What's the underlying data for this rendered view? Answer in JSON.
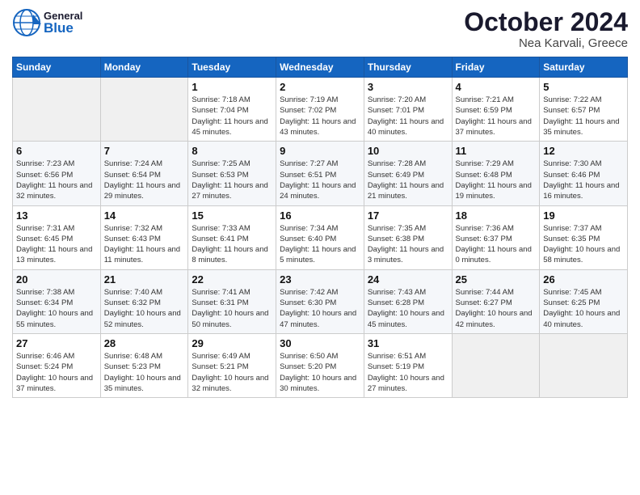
{
  "header": {
    "logo_general": "General",
    "logo_blue": "Blue",
    "title": "October 2024",
    "subtitle": "Nea Karvali, Greece"
  },
  "days_of_week": [
    "Sunday",
    "Monday",
    "Tuesday",
    "Wednesday",
    "Thursday",
    "Friday",
    "Saturday"
  ],
  "weeks": [
    [
      {
        "num": "",
        "info": ""
      },
      {
        "num": "",
        "info": ""
      },
      {
        "num": "1",
        "info": "Sunrise: 7:18 AM\nSunset: 7:04 PM\nDaylight: 11 hours and 45 minutes."
      },
      {
        "num": "2",
        "info": "Sunrise: 7:19 AM\nSunset: 7:02 PM\nDaylight: 11 hours and 43 minutes."
      },
      {
        "num": "3",
        "info": "Sunrise: 7:20 AM\nSunset: 7:01 PM\nDaylight: 11 hours and 40 minutes."
      },
      {
        "num": "4",
        "info": "Sunrise: 7:21 AM\nSunset: 6:59 PM\nDaylight: 11 hours and 37 minutes."
      },
      {
        "num": "5",
        "info": "Sunrise: 7:22 AM\nSunset: 6:57 PM\nDaylight: 11 hours and 35 minutes."
      }
    ],
    [
      {
        "num": "6",
        "info": "Sunrise: 7:23 AM\nSunset: 6:56 PM\nDaylight: 11 hours and 32 minutes."
      },
      {
        "num": "7",
        "info": "Sunrise: 7:24 AM\nSunset: 6:54 PM\nDaylight: 11 hours and 29 minutes."
      },
      {
        "num": "8",
        "info": "Sunrise: 7:25 AM\nSunset: 6:53 PM\nDaylight: 11 hours and 27 minutes."
      },
      {
        "num": "9",
        "info": "Sunrise: 7:27 AM\nSunset: 6:51 PM\nDaylight: 11 hours and 24 minutes."
      },
      {
        "num": "10",
        "info": "Sunrise: 7:28 AM\nSunset: 6:49 PM\nDaylight: 11 hours and 21 minutes."
      },
      {
        "num": "11",
        "info": "Sunrise: 7:29 AM\nSunset: 6:48 PM\nDaylight: 11 hours and 19 minutes."
      },
      {
        "num": "12",
        "info": "Sunrise: 7:30 AM\nSunset: 6:46 PM\nDaylight: 11 hours and 16 minutes."
      }
    ],
    [
      {
        "num": "13",
        "info": "Sunrise: 7:31 AM\nSunset: 6:45 PM\nDaylight: 11 hours and 13 minutes."
      },
      {
        "num": "14",
        "info": "Sunrise: 7:32 AM\nSunset: 6:43 PM\nDaylight: 11 hours and 11 minutes."
      },
      {
        "num": "15",
        "info": "Sunrise: 7:33 AM\nSunset: 6:41 PM\nDaylight: 11 hours and 8 minutes."
      },
      {
        "num": "16",
        "info": "Sunrise: 7:34 AM\nSunset: 6:40 PM\nDaylight: 11 hours and 5 minutes."
      },
      {
        "num": "17",
        "info": "Sunrise: 7:35 AM\nSunset: 6:38 PM\nDaylight: 11 hours and 3 minutes."
      },
      {
        "num": "18",
        "info": "Sunrise: 7:36 AM\nSunset: 6:37 PM\nDaylight: 11 hours and 0 minutes."
      },
      {
        "num": "19",
        "info": "Sunrise: 7:37 AM\nSunset: 6:35 PM\nDaylight: 10 hours and 58 minutes."
      }
    ],
    [
      {
        "num": "20",
        "info": "Sunrise: 7:38 AM\nSunset: 6:34 PM\nDaylight: 10 hours and 55 minutes."
      },
      {
        "num": "21",
        "info": "Sunrise: 7:40 AM\nSunset: 6:32 PM\nDaylight: 10 hours and 52 minutes."
      },
      {
        "num": "22",
        "info": "Sunrise: 7:41 AM\nSunset: 6:31 PM\nDaylight: 10 hours and 50 minutes."
      },
      {
        "num": "23",
        "info": "Sunrise: 7:42 AM\nSunset: 6:30 PM\nDaylight: 10 hours and 47 minutes."
      },
      {
        "num": "24",
        "info": "Sunrise: 7:43 AM\nSunset: 6:28 PM\nDaylight: 10 hours and 45 minutes."
      },
      {
        "num": "25",
        "info": "Sunrise: 7:44 AM\nSunset: 6:27 PM\nDaylight: 10 hours and 42 minutes."
      },
      {
        "num": "26",
        "info": "Sunrise: 7:45 AM\nSunset: 6:25 PM\nDaylight: 10 hours and 40 minutes."
      }
    ],
    [
      {
        "num": "27",
        "info": "Sunrise: 6:46 AM\nSunset: 5:24 PM\nDaylight: 10 hours and 37 minutes."
      },
      {
        "num": "28",
        "info": "Sunrise: 6:48 AM\nSunset: 5:23 PM\nDaylight: 10 hours and 35 minutes."
      },
      {
        "num": "29",
        "info": "Sunrise: 6:49 AM\nSunset: 5:21 PM\nDaylight: 10 hours and 32 minutes."
      },
      {
        "num": "30",
        "info": "Sunrise: 6:50 AM\nSunset: 5:20 PM\nDaylight: 10 hours and 30 minutes."
      },
      {
        "num": "31",
        "info": "Sunrise: 6:51 AM\nSunset: 5:19 PM\nDaylight: 10 hours and 27 minutes."
      },
      {
        "num": "",
        "info": ""
      },
      {
        "num": "",
        "info": ""
      }
    ]
  ]
}
